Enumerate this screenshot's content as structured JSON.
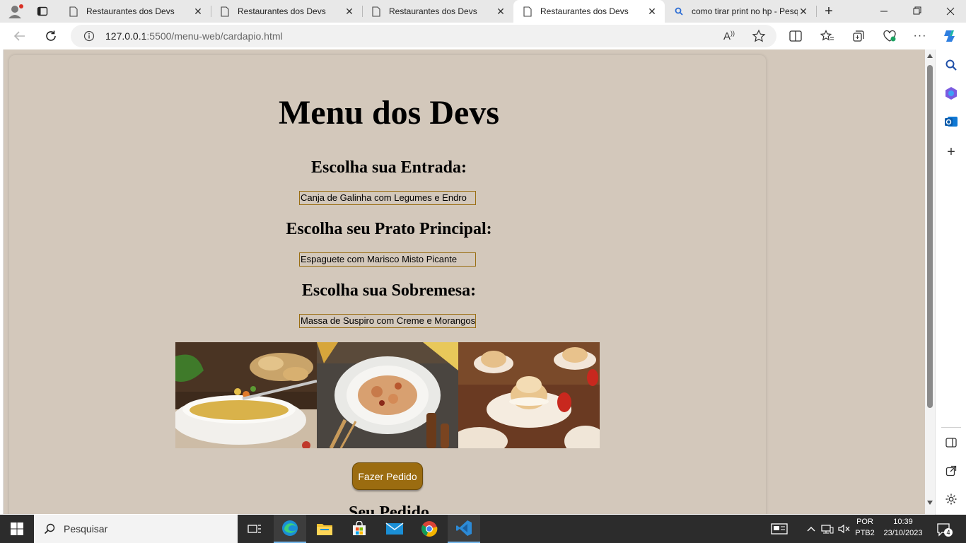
{
  "browser": {
    "tabs": [
      {
        "title": "Restaurantes dos Devs",
        "active": false
      },
      {
        "title": "Restaurantes dos Devs",
        "active": false
      },
      {
        "title": "Restaurantes dos Devs",
        "active": false
      },
      {
        "title": "Restaurantes dos Devs",
        "active": true
      },
      {
        "title": "como tirar print no hp - Pesq",
        "active": false
      }
    ],
    "url_host": "127.0.0.1",
    "url_path": ":5500/menu-web/cardapio.html",
    "icons": [
      "profile-icon",
      "tab-actions-icon",
      "new-tab-icon",
      "minimize-icon",
      "restore-icon",
      "close-window-icon",
      "back-icon",
      "refresh-icon",
      "site-info-icon",
      "read-aloud-icon",
      "favorite-icon",
      "split-screen-icon",
      "favorites-icon",
      "collections-icon",
      "browser-essentials-icon",
      "more-icon",
      "copilot-icon"
    ]
  },
  "page": {
    "title": "Menu dos Devs",
    "starter_heading": "Escolha sua Entrada:",
    "starter_value": "Canja de Galinha com Legumes e Endro",
    "main_heading": "Escolha seu Prato Principal:",
    "main_value": "Espaguete com Marisco Misto Picante",
    "dessert_heading": "Escolha sua Sobremesa:",
    "dessert_value": "Massa de Suspiro com Creme e Morangos",
    "order_button": "Fazer Pedido",
    "order_heading": "Seu Pedido"
  },
  "taskbar": {
    "search_placeholder": "Pesquisar",
    "language": "POR",
    "layout": "PTB2",
    "time": "10:39",
    "date": "23/10/2023",
    "notifications": "4"
  }
}
